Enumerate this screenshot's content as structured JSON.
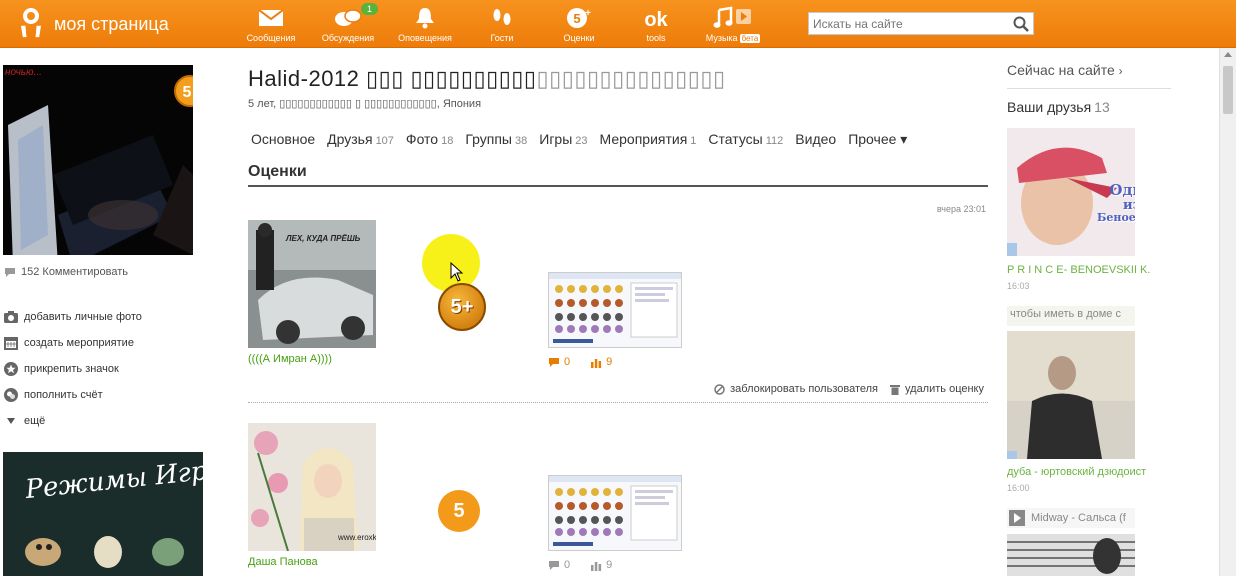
{
  "topbar": {
    "brand": "моя страница",
    "nav": [
      {
        "label": "Сообщения",
        "icon": "envelope-icon"
      },
      {
        "label": "Обсуждения",
        "icon": "chat-bubbles-icon",
        "badge": "1"
      },
      {
        "label": "Оповещения",
        "icon": "bell-icon"
      },
      {
        "label": "Гости",
        "icon": "footprints-icon"
      },
      {
        "label": "Оценки",
        "icon": "five-plus-icon"
      },
      {
        "label": "tools",
        "icon": "ok-icon"
      },
      {
        "label": "Музыка",
        "icon": "music-note-icon",
        "beta": "бета"
      }
    ],
    "search_placeholder": "Искать на сайте"
  },
  "left": {
    "avatar_caption": "ночью...",
    "comments": "152 Комментировать",
    "actions": [
      {
        "label": "добавить личные фото",
        "icon": "camera-icon"
      },
      {
        "label": "создать мероприятие",
        "icon": "calendar-icon"
      },
      {
        "label": "прикрепить значок",
        "icon": "star-badge-icon"
      },
      {
        "label": "пополнить счёт",
        "icon": "coins-icon"
      },
      {
        "label": "ещё",
        "icon": "triangle-down-icon"
      }
    ],
    "banner_text": "Режимы Игры:"
  },
  "profile": {
    "name": "Halid-2012 ▯▯▯ ▯▯▯▯▯▯▯▯▯▯",
    "name_ghost": "▯▯▯▯▯▯▯▯▯▯▯▯▯▯▯",
    "meta": "5 лет, ▯▯▯▯▯▯▯▯▯▯▯▯ ▯ ▯▯▯▯▯▯▯▯▯▯▯▯, Япония",
    "tabs": [
      {
        "label": "Основное",
        "count": ""
      },
      {
        "label": "Друзья",
        "count": "107"
      },
      {
        "label": "Фото",
        "count": "18"
      },
      {
        "label": "Группы",
        "count": "38"
      },
      {
        "label": "Игры",
        "count": "23"
      },
      {
        "label": "Мероприятия",
        "count": "1"
      },
      {
        "label": "Статусы",
        "count": "112"
      },
      {
        "label": "Видео",
        "count": ""
      },
      {
        "label": "Прочее ▾",
        "count": ""
      }
    ]
  },
  "ratings": {
    "title": "Оценки",
    "items": [
      {
        "time": "вчера 23:01",
        "photo_caption": "ЛЕХ, КУДА ПРЁШЬ",
        "rater": "((((А Имран А))))",
        "grade": "5+",
        "comments": "0",
        "marks": "9"
      },
      {
        "rater": "Даша Панова",
        "photo_caption": "www.eroxki",
        "grade": "5",
        "comments": "0",
        "marks": "9"
      }
    ],
    "block_user": "заблокировать пользователя",
    "delete_rating": "удалить оценку"
  },
  "right": {
    "online_now": "Сейчас на сайте",
    "online_arrow": "›",
    "friends_title": "Ваши друзья",
    "friends_count": "13",
    "friends": [
      {
        "name": "P R I N C E- BENOEVSKII K.",
        "time": "16:03",
        "photo_text_1": "Один",
        "photo_text_2": "из",
        "photo_text_3": "Беноевских"
      },
      {
        "name": "дуба - юртовский дзюдоист",
        "time": "16:00",
        "status": "чтобы иметь в доме с"
      }
    ],
    "music": "Midway - Сальса (f"
  },
  "colors": {
    "topbar": "#f7931e",
    "link_green": "#47a012",
    "accent_orange": "#e67e00"
  }
}
